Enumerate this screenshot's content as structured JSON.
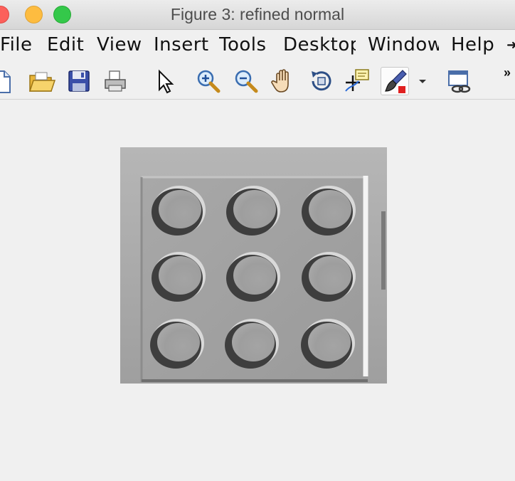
{
  "window": {
    "title": "Figure 3: refined normal"
  },
  "menu": {
    "items": [
      "File",
      "Edit",
      "View",
      "Insert",
      "Tools",
      "Desktop",
      "Window",
      "Help"
    ],
    "overflow_glyph": "➜"
  },
  "toolbar": {
    "tools": [
      "new-figure",
      "open-file",
      "save",
      "print",
      "edit-plot-pointer",
      "zoom-in",
      "zoom-out",
      "pan",
      "rotate-3d",
      "data-cursor",
      "brush",
      "brush-dropdown",
      "link-plot"
    ],
    "overflow_glyph": "»"
  },
  "figure": {
    "image_content": "grayscale normal map of a 3x3 grid of circular dimples on a square plate",
    "grid_rows": 3,
    "grid_cols": 3
  },
  "colors": {
    "titlebar": "#e4e4e4",
    "background": "#f0f0f0",
    "plate": "#a5a5a5",
    "brush_red": "#e02020"
  }
}
